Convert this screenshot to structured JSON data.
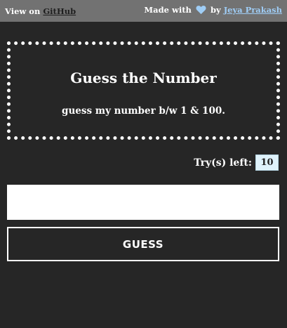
{
  "topbar": {
    "view_on": "View on",
    "github_link": "GitHub",
    "made_with": "Made with",
    "by": "by",
    "author_link": "Jeya Prakash",
    "heart_icon": "heart-icon",
    "heart_color": "#9fcdf6"
  },
  "panel": {
    "title": "Guess the Number",
    "subtitle": "guess my number b/w 1 & 100."
  },
  "tries": {
    "label": "Try(s) left:",
    "count": "10"
  },
  "guess": {
    "input_value": "",
    "button_label": "GUESS"
  }
}
